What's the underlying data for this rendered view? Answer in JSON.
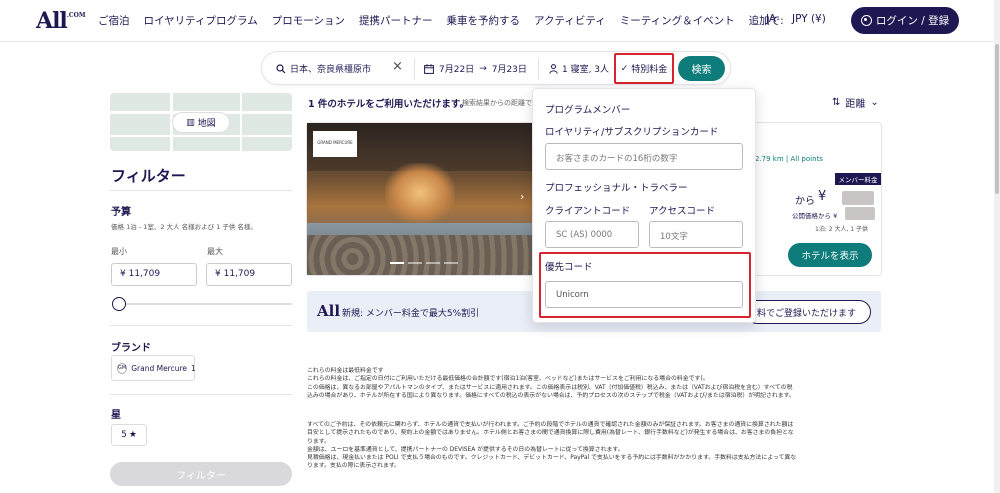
{
  "brand": {
    "logo": "All",
    "logo_sub": ".COM",
    "promo_logo": "All"
  },
  "nav": {
    "items": [
      "ご宿泊",
      "ロイヤリティプログラム",
      "プロモーション",
      "提携パートナー",
      "乗車を予約する",
      "アクティビティ",
      "ミーティング＆イベント",
      "追加で:"
    ],
    "lang": "JA",
    "currency": "JPY (¥)",
    "login": "ログイン / 登録"
  },
  "search": {
    "location": "日本、奈良県橿原市",
    "clear": "×",
    "date_from": "7月22日",
    "arrow": "→",
    "date_to": "7月23日",
    "guests": "1 寝室, 3人",
    "special_rate": "特別料金",
    "check": "✓",
    "search_button": "検索"
  },
  "map": {
    "button": "地図"
  },
  "filters": {
    "title": "フィルター",
    "budget_label": "予算",
    "budget_note": "価格 1泊 - 1室、2 大人 名様および 1 子供 名様。",
    "min_label": "最小",
    "max_label": "最大",
    "min_value": "¥ 11,709",
    "max_value": "¥ 11,709",
    "brand_label": "ブランド",
    "brand_chip": "Grand Mercure",
    "brand_count": "1",
    "star_label": "星",
    "star_value": "5",
    "star_glyph": "★",
    "apply_button": "フィルター"
  },
  "results": {
    "heading": "1 件のホテルをご利用いただけます。",
    "subnote": "検索結果からの距離で",
    "sort_label": "距離",
    "sort_icon": "⇅",
    "sort_chevron": "⌄"
  },
  "hotel": {
    "photo_logo": "GRAND MERCURE",
    "distance": "2.79 km",
    "points": "All points",
    "member_badge": "メンバー料金",
    "from": "から",
    "yen": "¥",
    "public_price": "公開価格から ¥",
    "per_night": "1泊: 2 大人, 1 子供",
    "view_button": "ホテルを表示",
    "next": "›"
  },
  "promo": {
    "text": "新規: メンバー料金で最大5%割引",
    "button": "料でご登録いただけます"
  },
  "dropdown": {
    "member_heading": "プログラムメンバー",
    "loyalty_label": "ロイヤリティ/サブスクリプションカード",
    "loyalty_placeholder": "お客さまのカードの16桁の数字",
    "pro_heading": "プロフェッショナル・トラベラー",
    "client_label": "クライアントコード",
    "access_label": "アクセスコード",
    "client_placeholder": "SC (AS) 0000",
    "access_placeholder": "10文字",
    "pref_label": "優先コード",
    "pref_value": "Unicorn"
  },
  "fineprint": {
    "p1": [
      "これらの料金は最低料金です",
      "これらの料金は、ご指定の日付にご利用いただける最低価格の合計額です(宿泊1泊(客室、ベッドなど)またはサービスをご利用になる場合の料金です)。",
      "この価格は、異なるお部屋やアパルトマンのタイプ、またはサービスに適用されます。この価格表示は税別、VAT（付加価値税）税込み、または（VATおよび宿泊税を含む）すべての税",
      "込みの場合があり、ホテルが所在する国により異なります。価格にすべての税込の表示がない場合は、予約プロセスの次のステップで税金（VATおよび/または宿泊税）が明記されます。"
    ],
    "p2": [
      "すべてのご予約は、その依頼元に関わらず、ホテルの通貨で支払いが行われます。ご予約の段階でホテルの通貨で確認された金額のみが保証されます。お客さまの通貨に換算された額は",
      "目安として提示されたものであり、契約上の金額ではありません。ホテル側とお客さまの間で通貨換算に際し費用(為替レート、銀行手数料など)が発生する場合は、お客さまの負担とな",
      "ります。",
      "金額は、ユーロを基準通貨として、提携パートナーの DEVISEA が提供するその日の為替レートに従って換算されます。",
      "見積価格は、現金払いまたは POLI で支払う場合のものです。クレジットカード、デビットカード、PayPal で支払いをする予約には手数料がかかります。手数料は支払方法によって異な",
      "ります。支払の際に表示されます。"
    ]
  }
}
